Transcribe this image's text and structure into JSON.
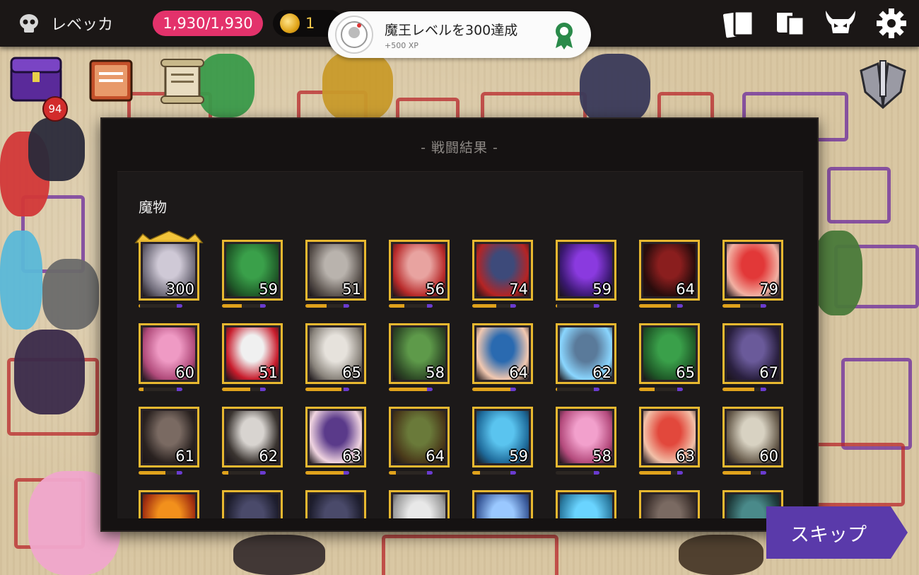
{
  "player": {
    "name": "レベッカ"
  },
  "status": {
    "hp": "1,930/1,930",
    "gold": "1"
  },
  "notification": {
    "title": "魔王レベルを300達成",
    "reward": "+500 XP"
  },
  "hud": {
    "chest_count": "94"
  },
  "top_icons": [
    "cards-icon",
    "book-icon",
    "demon-skull-icon",
    "settings-gear-icon"
  ],
  "panel": {
    "title": "- 戦闘結果 -",
    "section": "魔物"
  },
  "monsters": [
    {
      "level": "300",
      "progress": 0.04,
      "crown": true,
      "palette": [
        "#cfc9d6",
        "#6e6a78"
      ]
    },
    {
      "level": "59",
      "progress": 0.45,
      "palette": [
        "#3aa04a",
        "#1f5a28"
      ]
    },
    {
      "level": "51",
      "progress": 0.48,
      "palette": [
        "#b9b3ad",
        "#5b534e"
      ]
    },
    {
      "level": "56",
      "progress": 0.35,
      "palette": [
        "#e8a3a0",
        "#b82a2a"
      ]
    },
    {
      "level": "74",
      "progress": 0.55,
      "palette": [
        "#3d4a7a",
        "#b52424"
      ]
    },
    {
      "level": "59",
      "progress": 0.04,
      "palette": [
        "#8a3adf",
        "#3a1870"
      ]
    },
    {
      "level": "64",
      "progress": 0.72,
      "palette": [
        "#8a1e1e",
        "#2a0c0c"
      ]
    },
    {
      "level": "79",
      "progress": 0.4,
      "palette": [
        "#e23838",
        "#f2b0a2"
      ]
    },
    {
      "level": "60",
      "progress": 0.12,
      "palette": [
        "#ef9ac4",
        "#b04a7a"
      ]
    },
    {
      "level": "51",
      "progress": 0.65,
      "palette": [
        "#f0f0f0",
        "#c81c2c"
      ]
    },
    {
      "level": "65",
      "progress": 0.82,
      "palette": [
        "#e6e2dc",
        "#8a847c"
      ]
    },
    {
      "level": "58",
      "progress": 0.96,
      "palette": [
        "#5e9a4a",
        "#2e4a26"
      ]
    },
    {
      "level": "64",
      "progress": 0.95,
      "palette": [
        "#2a6ab0",
        "#f2c8b0"
      ]
    },
    {
      "level": "62",
      "progress": 0.04,
      "palette": [
        "#5a7a9a",
        "#8ad6ff"
      ]
    },
    {
      "level": "65",
      "progress": 0.35,
      "palette": [
        "#3aa04a",
        "#1f5a28"
      ]
    },
    {
      "level": "67",
      "progress": 0.72,
      "palette": [
        "#6a5a9a",
        "#2a2040"
      ]
    },
    {
      "level": "61",
      "progress": 0.62,
      "palette": [
        "#7a6a62",
        "#2a2220"
      ]
    },
    {
      "level": "62",
      "progress": 0.14,
      "palette": [
        "#d8d4d0",
        "#3a3430"
      ]
    },
    {
      "level": "63",
      "progress": 0.88,
      "palette": [
        "#5a3a8a",
        "#f0d4e0"
      ]
    },
    {
      "level": "64",
      "progress": 0.16,
      "palette": [
        "#6a7a3a",
        "#4a3a1a"
      ]
    },
    {
      "level": "59",
      "progress": 0.18,
      "palette": [
        "#5ac4ef",
        "#1e6a9a"
      ]
    },
    {
      "level": "58",
      "progress": 0.0,
      "palette": [
        "#f2a0cc",
        "#b44a7c"
      ]
    },
    {
      "level": "63",
      "progress": 0.72,
      "palette": [
        "#e2483c",
        "#f2c0a8"
      ]
    },
    {
      "level": "60",
      "progress": 0.65,
      "palette": [
        "#d8d2c2",
        "#6a5e4e"
      ]
    },
    {
      "level": "",
      "progress": 0.0,
      "palette": [
        "#f2901c",
        "#a43010"
      ]
    },
    {
      "level": "",
      "progress": 0.0,
      "palette": [
        "#4a4a6a",
        "#1e1e2e"
      ]
    },
    {
      "level": "",
      "progress": 0.0,
      "palette": [
        "#4a4a6a",
        "#1e1e2e"
      ]
    },
    {
      "level": "",
      "progress": 0.0,
      "palette": [
        "#e8e8e8",
        "#9a9a9a"
      ]
    },
    {
      "level": "",
      "progress": 0.0,
      "palette": [
        "#9ac8ff",
        "#3a5a9a"
      ]
    },
    {
      "level": "",
      "progress": 0.0,
      "palette": [
        "#6ad4ff",
        "#2a7aa0"
      ]
    },
    {
      "level": "",
      "progress": 0.0,
      "palette": [
        "#7a6a62",
        "#3a2e2a"
      ]
    },
    {
      "level": "",
      "progress": 0.0,
      "palette": [
        "#4a8a8a",
        "#1e3a3a"
      ]
    }
  ],
  "skip_label": "スキップ",
  "colors": {
    "frame_gold": "#e8b830",
    "hp_pink": "#e3326b",
    "skip_purple": "#5a3aaa",
    "panel_bg": "#151212"
  }
}
